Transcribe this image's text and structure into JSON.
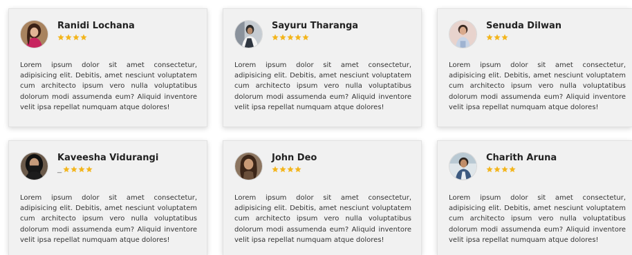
{
  "review_text": "Lorem ipsum dolor sit amet consectetur, adipisicing elit. Debitis, amet nesciunt voluptatem cum architecto ipsum vero nulla voluptatibus dolorum modi assumenda eum? Aliquid inventore velit ipsa repellat numquam atque dolores!",
  "star_color": "#f3b51c",
  "card_background": "#f1f1f1",
  "cards": [
    {
      "name": "Ranidi Lochana",
      "rating": 4,
      "prefix": ""
    },
    {
      "name": "Sayuru Tharanga",
      "rating": 5,
      "prefix": ""
    },
    {
      "name": "Senuda Dilwan",
      "rating": 3,
      "prefix": ""
    },
    {
      "name": "Kaveesha Vidurangi",
      "rating": 4,
      "prefix": "_"
    },
    {
      "name": "John Deo",
      "rating": 4,
      "prefix": ""
    },
    {
      "name": "Charith Aruna",
      "rating": 4,
      "prefix": ""
    }
  ]
}
